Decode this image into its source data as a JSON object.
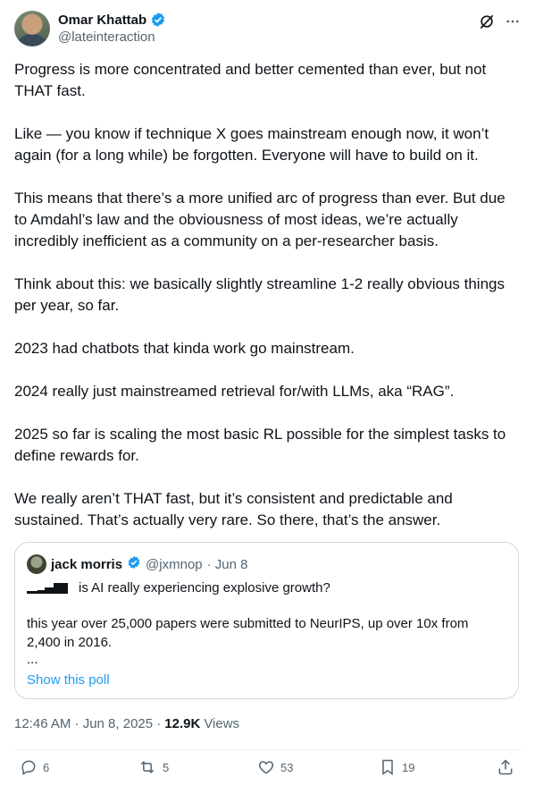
{
  "author": {
    "name": "Omar Khattab",
    "handle": "@lateinteraction"
  },
  "tweet": {
    "paragraphs": [
      "Progress is more concentrated and better cemented than ever, but not THAT fast.",
      "Like — you know if technique X goes mainstream enough now, it won’t again (for a long while) be forgotten. Everyone will have to build on it.",
      "This means that there’s a more unified arc of progress than ever. But due to Amdahl’s law and the obviousness of most ideas, we’re actually incredibly inefficient as a community on a per-researcher basis.",
      "Think about this: we basically slightly streamline 1-2 really obvious things per year, so far.",
      "2023 had chatbots that kinda work go mainstream.",
      "2024 really just mainstreamed retrieval for/with LLMs, aka “RAG”.",
      "2025 so far is scaling the most basic RL possible for the simplest tasks to define rewards for.",
      "We really aren’t THAT fast, but it’s consistent and predictable and sustained. That’s actually very rare. So there, that’s the answer."
    ]
  },
  "quote": {
    "name": "jack morris",
    "handle": "@jxmnop",
    "date": "· Jun 8",
    "poll_question": "is AI really experiencing explosive growth?",
    "body": "this year over 25,000 papers were submitted to NeurIPS, up over 10x from 2,400 in 2016.",
    "ellipsis": "...",
    "show_poll": "Show this poll"
  },
  "meta": {
    "time": "12:46 AM · Jun 8, 2025 ·",
    "views_count": "12.9K",
    "views_label": "Views"
  },
  "actions": {
    "replies": "6",
    "reposts": "5",
    "likes": "53",
    "bookmarks": "19"
  },
  "colors": {
    "accent": "#1d9bf0",
    "text": "#0f1419",
    "muted": "#536471",
    "border": "#cfd9de"
  }
}
